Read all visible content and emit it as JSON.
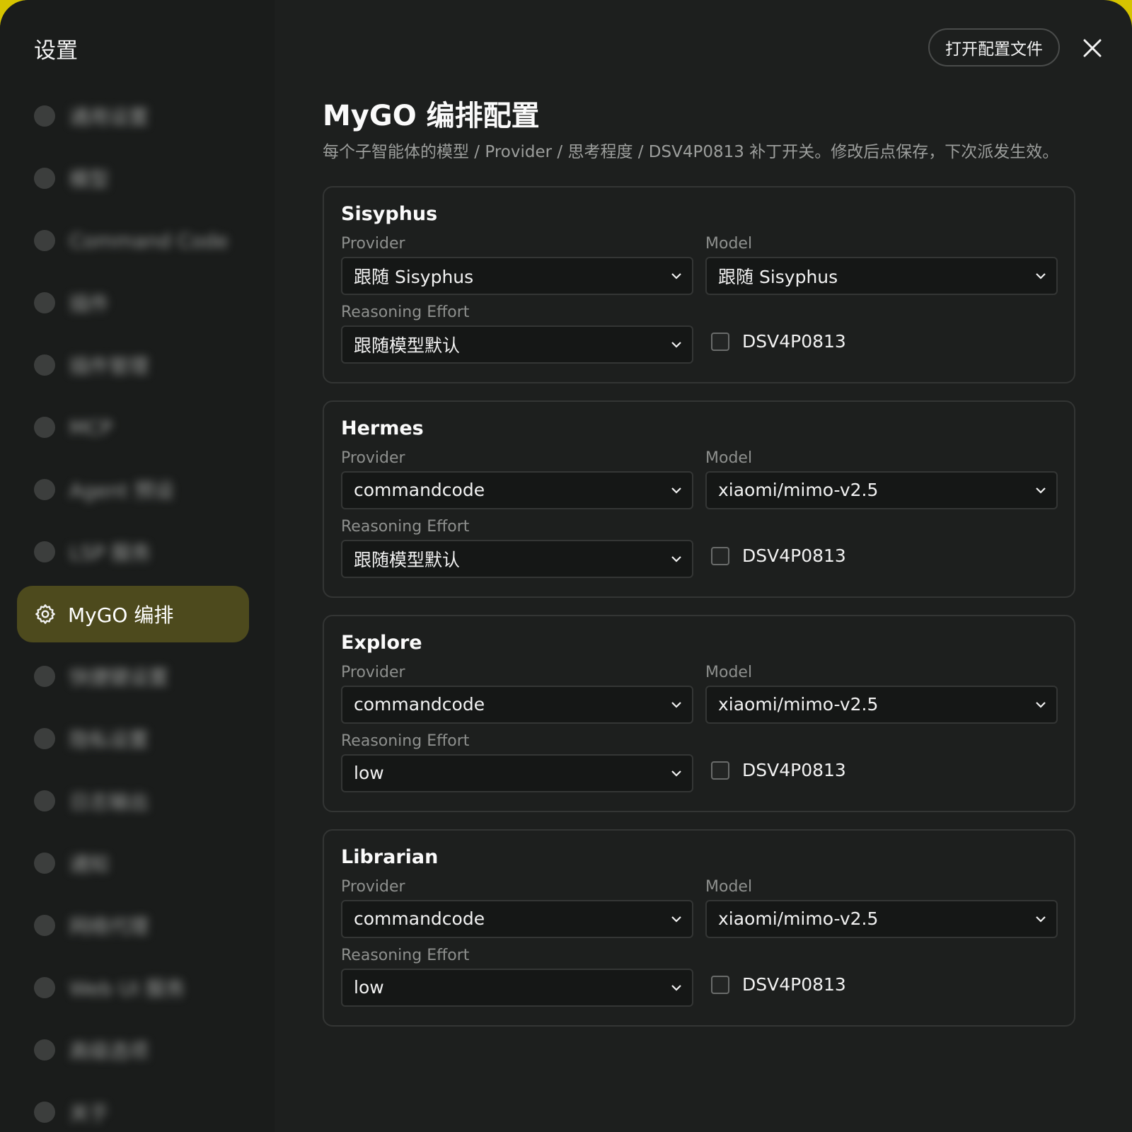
{
  "modal": {
    "title": "设置",
    "open_config_label": "打开配置文件"
  },
  "sidebar": {
    "items": [
      {
        "label": "通用设置",
        "blurred": true
      },
      {
        "label": "模型",
        "blurred": true
      },
      {
        "label": "Command Code",
        "blurred": true
      },
      {
        "label": "插件",
        "blurred": true
      },
      {
        "label": "插件管理",
        "blurred": true
      },
      {
        "label": "MCP",
        "blurred": true
      },
      {
        "label": "Agent 预设",
        "blurred": true
      },
      {
        "label": "LSP 服务",
        "blurred": true
      },
      {
        "label": "MyGO 编排",
        "active": true
      },
      {
        "label": "快捷键设置",
        "blurred": true
      },
      {
        "label": "隐私设置",
        "blurred": true
      },
      {
        "label": "日志输出",
        "blurred": true
      },
      {
        "label": "通知",
        "blurred": true
      },
      {
        "label": "网络代理",
        "blurred": true
      },
      {
        "label": "Web UI 服务",
        "blurred": true
      },
      {
        "label": "高级选项",
        "blurred": true
      },
      {
        "label": "关于",
        "blurred": true
      }
    ]
  },
  "main": {
    "title": "MyGO 编排配置",
    "description": "每个子智能体的模型 / Provider / 思考程度 / DSV4P0813 补丁开关。修改后点保存，下次派发生效。",
    "labels": {
      "provider": "Provider",
      "model": "Model",
      "reasoning": "Reasoning Effort",
      "patch": "DSV4P0813"
    },
    "agents": [
      {
        "name": "Sisyphus",
        "provider": "跟随 Sisyphus",
        "model": "跟随 Sisyphus",
        "reasoning": "跟随模型默认",
        "patch_enabled": false
      },
      {
        "name": "Hermes",
        "provider": "commandcode",
        "model": "xiaomi/mimo-v2.5",
        "reasoning": "跟随模型默认",
        "patch_enabled": false
      },
      {
        "name": "Explore",
        "provider": "commandcode",
        "model": "xiaomi/mimo-v2.5",
        "reasoning": "low",
        "patch_enabled": false
      },
      {
        "name": "Librarian",
        "provider": "commandcode",
        "model": "xiaomi/mimo-v2.5",
        "reasoning": "low",
        "patch_enabled": false
      }
    ]
  },
  "icons": {
    "close": "close-icon",
    "active_nav": "gear-icon",
    "select": "chevron-down-icon"
  },
  "colors": {
    "background": "#1d1f1e",
    "sidebar_active": "#4d4a1d",
    "accent_edge": "#d6c400"
  }
}
